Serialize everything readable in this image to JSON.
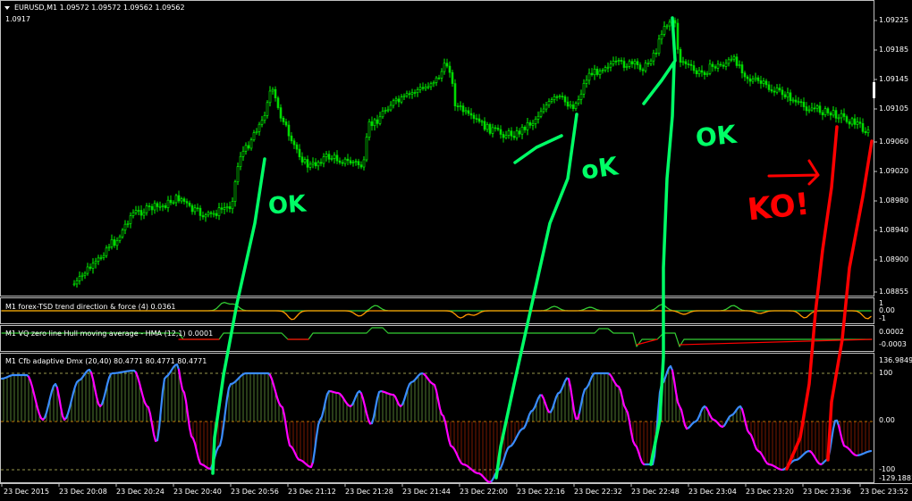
{
  "main": {
    "header": "EURUSD,M1  1.09572 1.09572 1.09562 1.09562",
    "sub_value": "1.0917",
    "price_ticks": [
      "1.09225",
      "1.09185",
      "1.09145",
      "1.09105",
      "1.09060",
      "1.09020",
      "1.08980",
      "1.08940",
      "1.08900",
      "1.08855"
    ]
  },
  "panes": {
    "tsd": {
      "title": "M1 forex-TSD trend direction & force (4) 0.0361",
      "ticks": [
        "1",
        "0.00",
        "-1"
      ]
    },
    "vq": {
      "title": "M1 VQ zero line Hull moving average - HMA (12,1) 0.0001",
      "ticks": [
        "0.0002",
        "-0.0003"
      ]
    },
    "cfb": {
      "title": "M1 Cfb adaptive Dmx (20,40) 80.4771 80.4771 80.4771",
      "ticks": [
        "136.9849",
        "100",
        "0.00",
        "-100",
        "-129.1881"
      ]
    }
  },
  "time_axis": [
    "23 Dec 2015",
    "23 Dec 20:08",
    "23 Dec 20:24",
    "23 Dec 20:40",
    "23 Dec 20:56",
    "23 Dec 21:12",
    "23 Dec 21:28",
    "23 Dec 21:44",
    "23 Dec 22:00",
    "23 Dec 22:16",
    "23 Dec 22:32",
    "23 Dec 22:48",
    "23 Dec 23:04",
    "23 Dec 23:20",
    "23 Dec 23:36",
    "23 Dec 23:52"
  ],
  "annotations": [
    "OK",
    "oK",
    "OK",
    "KO!"
  ],
  "colors": {
    "bull": "#00ff00",
    "bear": "#ff0000",
    "orange": "#ff9900",
    "blue": "#3a8cff",
    "magenta": "#ff00ff",
    "annot_green": "#00ff66",
    "annot_red": "#ff0000",
    "frame": "#c0c0c0"
  }
}
